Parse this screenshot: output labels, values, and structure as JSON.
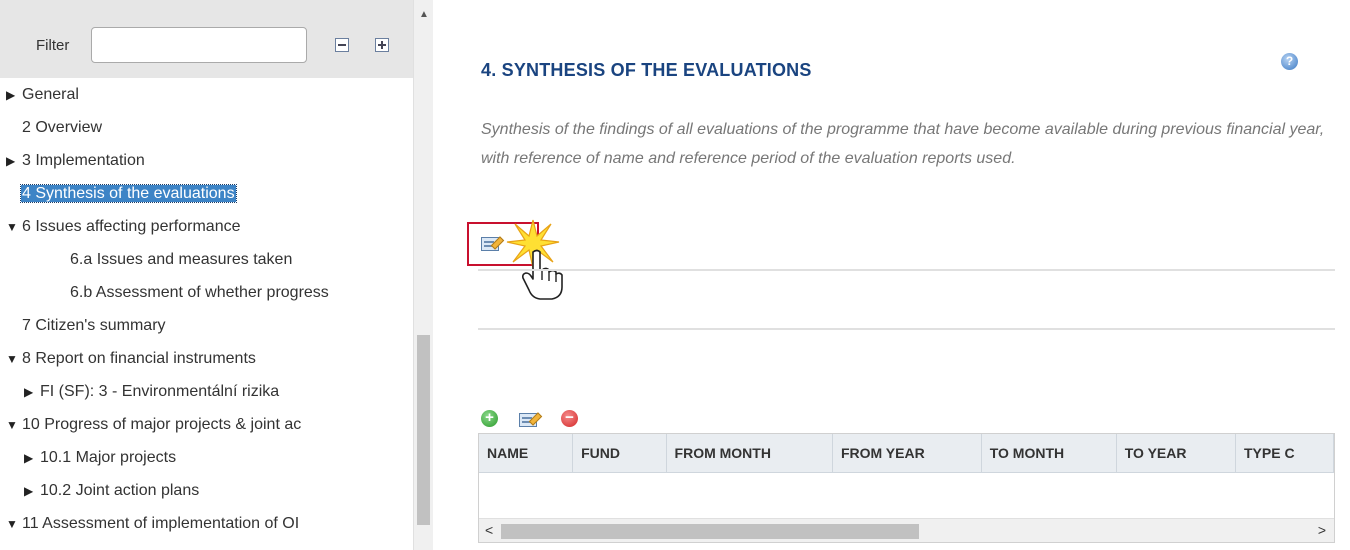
{
  "filter": {
    "label": "Filter",
    "value": "",
    "placeholder": ""
  },
  "tree": {
    "items": [
      {
        "label": "General",
        "toggle": "▶",
        "selected": false
      },
      {
        "label": "2 Overview",
        "toggle": "",
        "selected": false
      },
      {
        "label": "3 Implementation",
        "toggle": "▶",
        "selected": false
      },
      {
        "label": "4 Synthesis of the evaluations",
        "toggle": "",
        "selected": true
      },
      {
        "label": "6 Issues affecting performance",
        "toggle": "▼",
        "selected": false
      },
      {
        "label": "6.a Issues and measures taken",
        "toggle": "",
        "selected": false
      },
      {
        "label": "6.b Assessment of whether progress",
        "toggle": "",
        "selected": false
      },
      {
        "label": "7 Citizen's summary",
        "toggle": "",
        "selected": false
      },
      {
        "label": "8 Report on financial instruments",
        "toggle": "▼",
        "selected": false
      },
      {
        "label": "FI (SF): 3 - Environmentální rizika",
        "toggle": "▶",
        "selected": false
      },
      {
        "label": "10 Progress of major projects & joint ac",
        "toggle": "▼",
        "selected": false
      },
      {
        "label": "10.1 Major projects",
        "toggle": "▶",
        "selected": false
      },
      {
        "label": "10.2 Joint action plans",
        "toggle": "▶",
        "selected": false
      },
      {
        "label": "11 Assessment of implementation of OI",
        "toggle": "▼",
        "selected": false
      }
    ]
  },
  "main": {
    "title": "4. SYNTHESIS OF THE EVALUATIONS",
    "description": "Synthesis of the findings of all evaluations of the programme that have become available during previous financial year, with reference of name and reference period of the evaluation reports used.",
    "help_glyph": "?"
  },
  "table": {
    "columns": [
      "NAME",
      "FUND",
      "FROM MONTH",
      "FROM YEAR",
      "TO MONTH",
      "TO YEAR",
      "TYPE C"
    ],
    "rows": []
  },
  "colors": {
    "title": "#1a4480",
    "selected_bg": "#3d84c6",
    "highlight_border": "#c8102e"
  }
}
